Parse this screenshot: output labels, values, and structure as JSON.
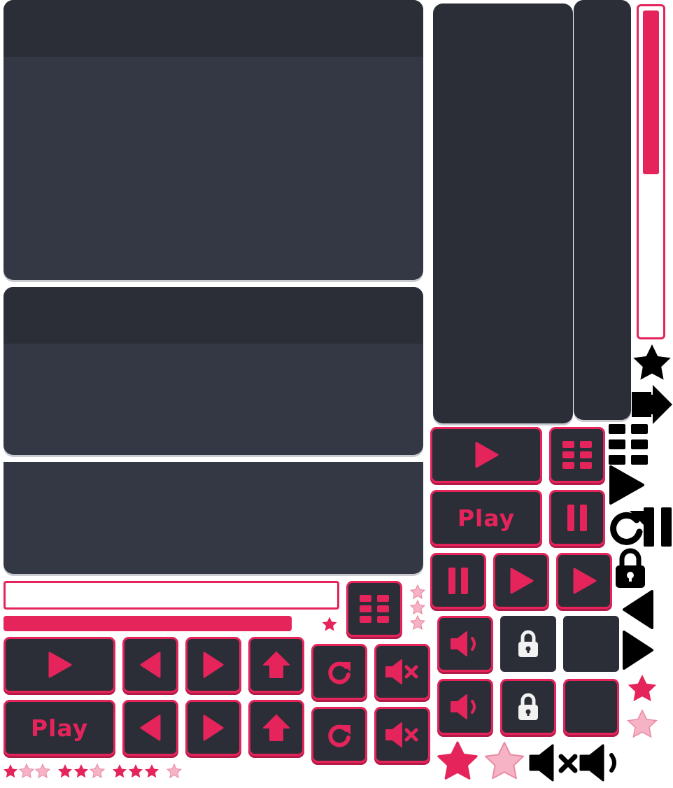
{
  "buttons": {
    "play_label_large": "Play",
    "play_label_small": "Play"
  },
  "colors": {
    "accent": "#e4245a",
    "accent_dark": "#b21a47",
    "accent_light": "#f7b3c6",
    "panel": "#343845",
    "panel_dark": "#2b2e37",
    "icon_white": "#f2f2f2",
    "icon_black": "#000000"
  },
  "progress": {
    "horizontal_bar_fill": 0.92,
    "horizontal_bar_empty": 0,
    "vertical_bar_fill": 0.5
  },
  "ratings": [
    {
      "filled": 1,
      "of": 3
    },
    {
      "filled": 2,
      "of": 3
    },
    {
      "filled": 3,
      "of": 3
    },
    {
      "filled": 0,
      "of": 1
    }
  ],
  "icons": [
    "play-icon",
    "pause-icon",
    "grid-icon",
    "arrow-left-icon",
    "arrow-right-icon",
    "arrow-up-icon",
    "refresh-icon",
    "mute-icon",
    "volume-icon",
    "lock-icon",
    "star-icon",
    "exit-icon"
  ]
}
